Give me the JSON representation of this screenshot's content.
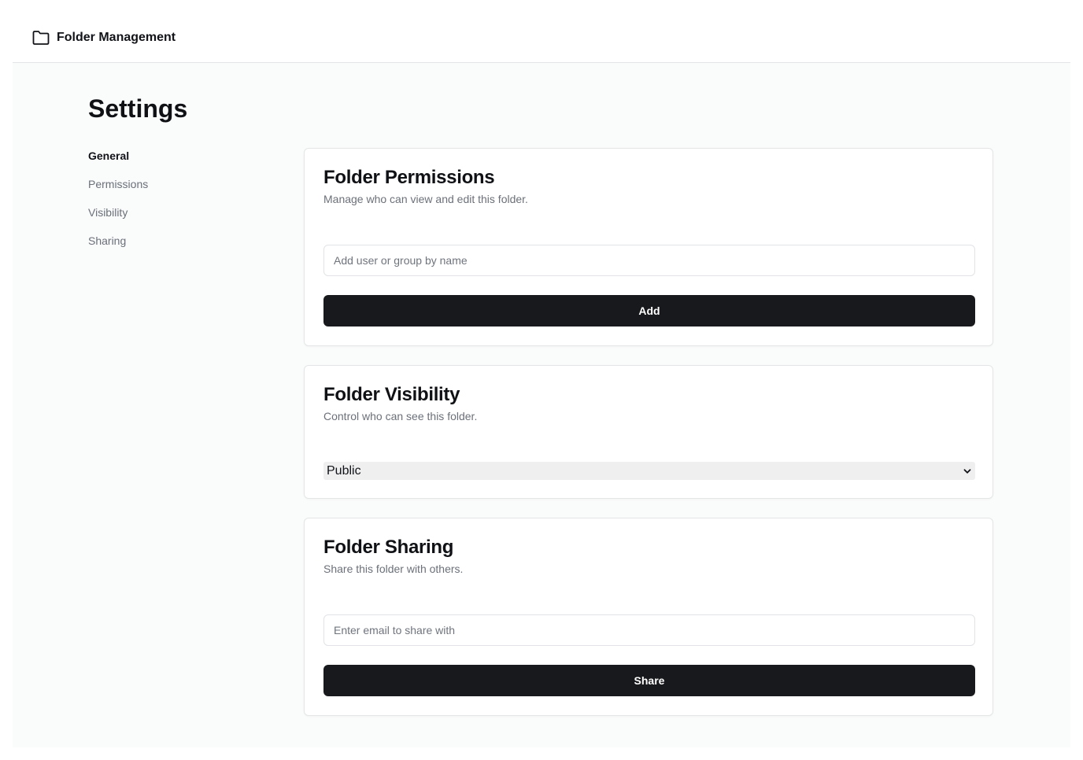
{
  "app": {
    "title": "Folder Management",
    "icon": "folder-icon"
  },
  "page": {
    "title": "Settings"
  },
  "sidebar": {
    "items": [
      {
        "label": "General",
        "active": true
      },
      {
        "label": "Permissions",
        "active": false
      },
      {
        "label": "Visibility",
        "active": false
      },
      {
        "label": "Sharing",
        "active": false
      }
    ]
  },
  "permissions": {
    "title": "Folder Permissions",
    "description": "Manage who can view and edit this folder.",
    "input_value": "",
    "input_placeholder": "Add user or group by name",
    "button_label": "Add"
  },
  "visibility": {
    "title": "Folder Visibility",
    "description": "Control who can see this folder.",
    "selected": "Public",
    "chevron_icon": "chevron-down-icon"
  },
  "sharing": {
    "title": "Folder Sharing",
    "description": "Share this folder with others.",
    "input_value": "",
    "input_placeholder": "Enter email to share with",
    "button_label": "Share"
  },
  "colors": {
    "primary_button": "#18191c",
    "background": "#fafbfb",
    "muted_text": "#6b7079",
    "border": "#e4e5e7"
  }
}
